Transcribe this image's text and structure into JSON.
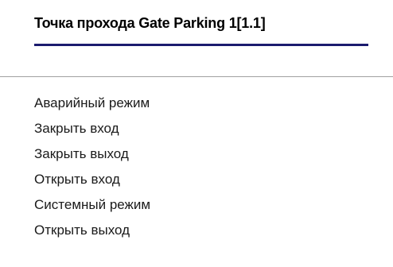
{
  "menu": {
    "title": "Точка прохода Gate Parking 1[1.1]",
    "items": [
      {
        "label": "Аварийный режим"
      },
      {
        "label": "Закрыть вход"
      },
      {
        "label": "Закрыть выход"
      },
      {
        "label": "Открыть вход"
      },
      {
        "label": "Системный режим"
      },
      {
        "label": "Открыть выход"
      }
    ]
  },
  "colors": {
    "background": "#ffffff",
    "title_underline": "#1b1b6e",
    "separator": "#a0a0a0",
    "text": "#1a1a1a"
  }
}
